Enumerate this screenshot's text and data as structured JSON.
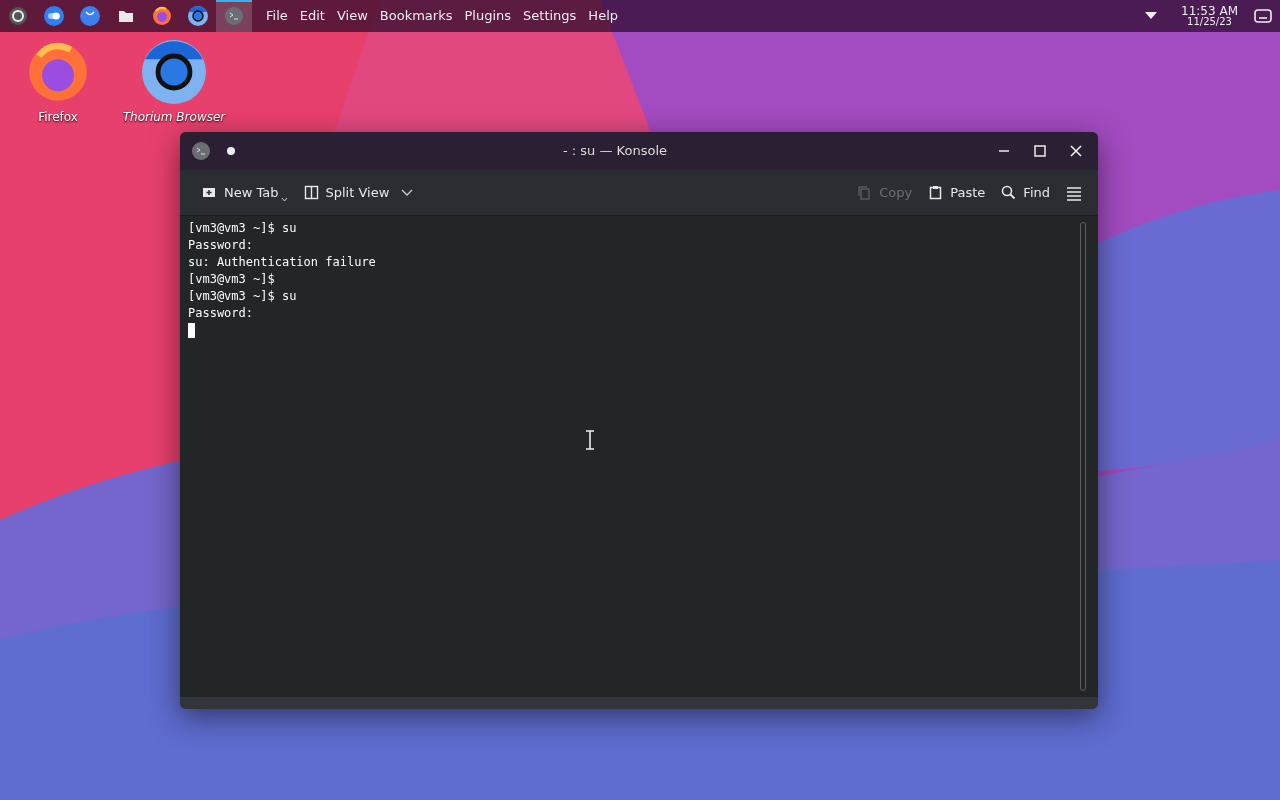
{
  "panel": {
    "launchers": [
      {
        "kind": "menu",
        "selected": false
      },
      {
        "kind": "toggle",
        "selected": false
      },
      {
        "kind": "bubble",
        "selected": false
      },
      {
        "kind": "folder",
        "selected": false
      },
      {
        "kind": "firefox",
        "selected": false
      },
      {
        "kind": "thorium",
        "selected": false
      },
      {
        "kind": "terminal",
        "selected": true
      }
    ],
    "menu_bar": [
      "File",
      "Edit",
      "View",
      "Bookmarks",
      "Plugins",
      "Settings",
      "Help"
    ],
    "clock": {
      "time": "11:53 AM",
      "date": "11/25/23"
    }
  },
  "desktop_icons": [
    {
      "kind": "firefox",
      "label": "Firefox"
    },
    {
      "kind": "thorium",
      "label": "Thorium Browser"
    }
  ],
  "window": {
    "title": "- : su — Konsole",
    "toolbar_left": [
      {
        "kind": "new-tab",
        "label": "New Tab",
        "disabled": false
      },
      {
        "kind": "split-view",
        "label": "Split View",
        "disabled": false
      }
    ],
    "toolbar_right": [
      {
        "kind": "copy",
        "label": "Copy",
        "disabled": true
      },
      {
        "kind": "paste",
        "label": "Paste",
        "disabled": false
      },
      {
        "kind": "find",
        "label": "Find",
        "disabled": false
      },
      {
        "kind": "menu",
        "disabled": false
      }
    ],
    "terminal_lines": [
      "[vm3@vm3 ~]$ su",
      "Password:",
      "su: Authentication failure",
      "[vm3@vm3 ~]$",
      "[vm3@vm3 ~]$ su",
      "Password:"
    ],
    "cursor_visible": true
  }
}
